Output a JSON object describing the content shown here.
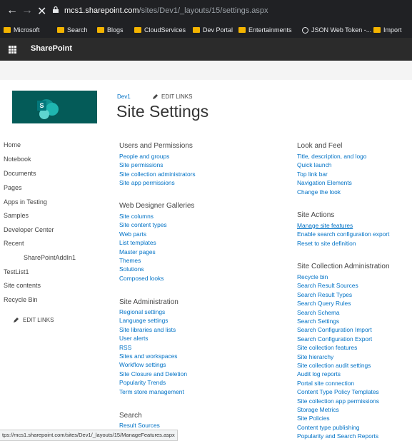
{
  "browser": {
    "url_host": "mcs1.sharepoint.com",
    "url_path": "/sites/Dev1/_layouts/15/settings.aspx",
    "bookmarks": [
      "Microsoft",
      "Search",
      "Blogs",
      "CloudServices",
      "Dev Portal",
      "Entertainments",
      "JSON Web Token -...",
      "Import"
    ],
    "status_url": "tps://mcs1.sharepoint.com/sites/Dev1/_layouts/15/ManageFeatures.aspx"
  },
  "suite": {
    "brand": "SharePoint"
  },
  "site": {
    "logo_letter": "S",
    "breadcrumb": "Dev1",
    "edit_links": "EDIT LINKS",
    "title": "Site Settings"
  },
  "leftnav": {
    "items": [
      "Home",
      "Notebook",
      "Documents",
      "Pages",
      "Apps in Testing",
      "Samples",
      "Developer Center",
      "Recent",
      "SharePointAddIn1",
      "TestList1",
      "Site contents",
      "Recycle Bin"
    ],
    "edit_links": "EDIT LINKS"
  },
  "sections": {
    "users": {
      "title": "Users and Permissions",
      "links": [
        "People and groups",
        "Site permissions",
        "Site collection administrators",
        "Site app permissions"
      ]
    },
    "galleries": {
      "title": "Web Designer Galleries",
      "links": [
        "Site columns",
        "Site content types",
        "Web parts",
        "List templates",
        "Master pages",
        "Themes",
        "Solutions",
        "Composed looks"
      ]
    },
    "admin": {
      "title": "Site Administration",
      "links": [
        "Regional settings",
        "Language settings",
        "Site libraries and lists",
        "User alerts",
        "RSS",
        "Sites and workspaces",
        "Workflow settings",
        "Site Closure and Deletion",
        "Popularity Trends",
        "Term store management"
      ]
    },
    "search": {
      "title": "Search",
      "links": [
        "Result Sources"
      ]
    },
    "look": {
      "title": "Look and Feel",
      "links": [
        "Title, description, and logo",
        "Quick launch",
        "Top link bar",
        "Navigation Elements",
        "Change the look"
      ]
    },
    "actions": {
      "title": "Site Actions",
      "links": [
        "Manage site features",
        "Enable search configuration export",
        "Reset to site definition"
      ]
    },
    "collection": {
      "title": "Site Collection Administration",
      "links": [
        "Recycle bin",
        "Search Result Sources",
        "Search Result Types",
        "Search Query Rules",
        "Search Schema",
        "Search Settings",
        "Search Configuration Import",
        "Search Configuration Export",
        "Site collection features",
        "Site hierarchy",
        "Site collection audit settings",
        "Audit log reports",
        "Portal site connection",
        "Content Type Policy Templates",
        "Site collection app permissions",
        "Storage Metrics",
        "Site Policies",
        "Content type publishing",
        "Popularity and Search Reports"
      ]
    }
  }
}
